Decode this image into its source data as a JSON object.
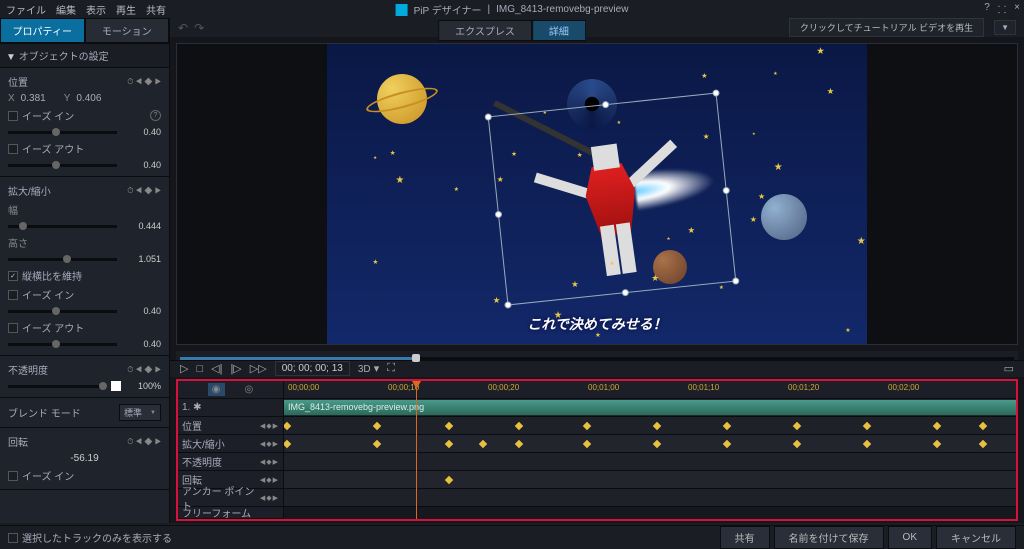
{
  "menubar": [
    "ファイル",
    "編集",
    "表示",
    "再生",
    "共有"
  ],
  "app_title": "PiP デザイナー",
  "document_title": "IMG_8413-removebg-preview",
  "win_controls": [
    "?",
    "⸬",
    "×"
  ],
  "sidebar": {
    "tabs": {
      "properties": "プロパティー",
      "motion": "モーション"
    },
    "section": "オブジェクトの設定",
    "position": {
      "title": "位置",
      "x_label": "X",
      "x_value": "0.381",
      "y_label": "Y",
      "y_value": "0.406",
      "ease_in": "イーズ イン",
      "ease_in_val": "0.40",
      "ease_out": "イーズ アウト",
      "ease_out_val": "0.40"
    },
    "scale": {
      "title": "拡大/縮小",
      "width_label": "幅",
      "width_val": "0.444",
      "height_label": "高さ",
      "height_val": "1.051",
      "keep_aspect": "縦横比を維持",
      "ease_in": "イーズ イン",
      "ease_in_val": "0.40",
      "ease_out": "イーズ アウト",
      "ease_out_val": "0.40"
    },
    "opacity": {
      "title": "不透明度",
      "value": "100%"
    },
    "blend": {
      "label": "ブレンド モード",
      "value": "標準"
    },
    "rotation": {
      "title": "回転",
      "value": "-56.19",
      "ease_in": "イーズ イン"
    }
  },
  "mode_tabs": {
    "express": "エクスプレス",
    "detail": "詳細"
  },
  "tutorial_btn": "クリックしてチュートリアル ビデオを再生",
  "preview": {
    "subtitle": "これで決めてみせる！"
  },
  "transport": {
    "timecode": "00; 00; 00; 13",
    "mode3d": "3D"
  },
  "timeline": {
    "ruler": [
      "00;00;00",
      "00;00;10",
      "00;00;20",
      "00;01;00",
      "00;01;10",
      "00;01;20",
      "00;02;00"
    ],
    "clip_row": {
      "label": "1. ✱",
      "clip_name": "IMG_8413-removebg-preview.png"
    },
    "tracks": [
      "位置",
      "拡大/縮小",
      "不透明度",
      "回転",
      "アンカー ポイント",
      "フリーフォーム"
    ],
    "keyframes": {
      "pos": [
        0,
        90,
        162,
        232,
        300,
        370,
        440,
        510,
        580,
        650,
        696
      ],
      "scale": [
        0,
        90,
        162,
        196,
        232,
        300,
        370,
        440,
        510,
        580,
        650,
        696
      ],
      "rot": [
        162
      ]
    }
  },
  "footer": {
    "checkbox": "選択したトラックのみを表示する",
    "buttons": {
      "share": "共有",
      "save_as": "名前を付けて保存",
      "ok": "OK",
      "cancel": "キャンセル"
    }
  }
}
